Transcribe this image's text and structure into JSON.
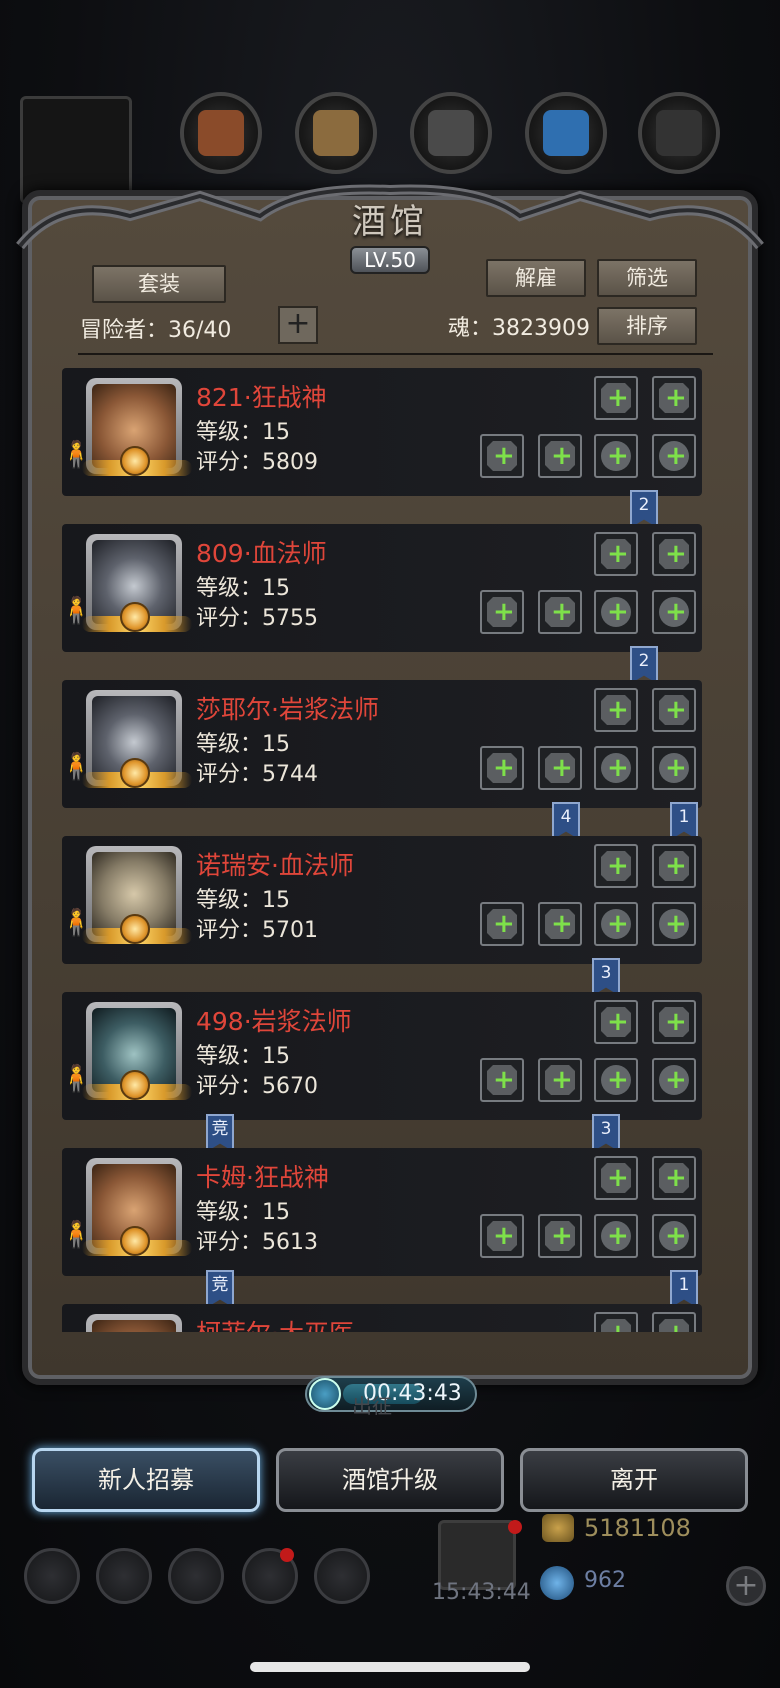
{
  "title": "酒馆",
  "level": "LV.50",
  "buttons": {
    "suit": "套装",
    "dismiss": "解雇",
    "filter": "筛选",
    "sort": "排序",
    "plus": "+"
  },
  "adventurers_label": "冒险者：36/40",
  "soul_label": "魂：3823909",
  "heroes": [
    {
      "name": "821·狂战神",
      "level": "等级：15",
      "score": "评分：5809"
    },
    {
      "name": "809·血法师",
      "level": "等级：15",
      "score": "评分：5755"
    },
    {
      "name": "莎耶尔·岩浆法师",
      "level": "等级：15",
      "score": "评分：5744"
    },
    {
      "name": "诺瑞安·血法师",
      "level": "等级：15",
      "score": "评分：5701"
    },
    {
      "name": "498·岩浆法师",
      "level": "等级：15",
      "score": "评分：5670"
    },
    {
      "name": "卡姆·狂战神",
      "level": "等级：15",
      "score": "评分：5613"
    },
    {
      "name": "柯菲尔·大巫医",
      "level": "",
      "score": ""
    }
  ],
  "badges": {
    "b1": "2",
    "b2": "2",
    "b3a": "4",
    "b3b": "1",
    "b4": "3",
    "b5a": "竞",
    "b5b": "3",
    "b6a": "竞",
    "b6b": "1"
  },
  "timer": "00:43:43",
  "bottom_buttons": {
    "recruit": "新人招募",
    "upgrade": "酒馆升级",
    "leave": "离开"
  },
  "background": {
    "chuzheng": "出征",
    "gold": "5181108",
    "gems": "962",
    "clock": "15:43:44",
    "plus": "+"
  },
  "colors": {
    "name_red": "#e0463a",
    "equip_green": "#7ee04a",
    "badge_blue": "#2e4f86"
  }
}
